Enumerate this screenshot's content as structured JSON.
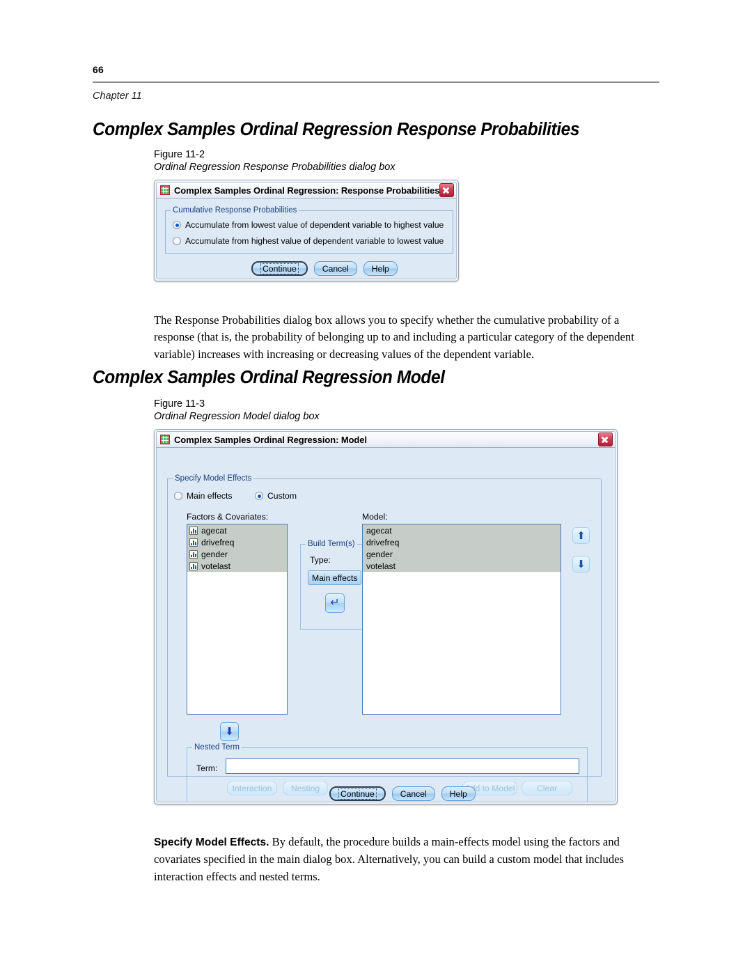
{
  "page": {
    "number": "66",
    "chapter": "Chapter 11"
  },
  "sections": [
    {
      "title": "Complex Samples Ordinal Regression Response Probabilities",
      "figure_number": "Figure 11-2",
      "figure_desc": "Ordinal Regression Response Probabilities dialog box"
    },
    {
      "title": "Complex Samples Ordinal Regression Model",
      "figure_number": "Figure 11-3",
      "figure_desc": "Ordinal Regression Model dialog box"
    }
  ],
  "paragraphs": {
    "response_probabilities": "The Response Probabilities dialog box allows you to specify whether the cumulative probability of a response (that is, the probability of belonging up to and including a particular category of the dependent variable) increases with increasing or decreasing values of the dependent variable.",
    "model_effects_lead": "Specify Model Effects.",
    "model_effects_rest": " By default, the procedure builds a main-effects model using the factors and covariates specified in the main dialog box. Alternatively, you can build a custom model that includes interaction effects and nested terms."
  },
  "dialog_response_probabilities": {
    "title": "Complex Samples Ordinal Regression: Response Probabilities",
    "close_icon": "close-icon",
    "app_icon": "spss-app-icon",
    "group_title": "Cumulative Response Probabilities",
    "radios": [
      {
        "label": "Accumulate from lowest value of dependent variable to highest value",
        "checked": true
      },
      {
        "label": "Accumulate from highest value of dependent variable to lowest value",
        "checked": false
      }
    ],
    "buttons": [
      {
        "label": "Continue",
        "default": true
      },
      {
        "label": "Cancel",
        "default": false
      },
      {
        "label": "Help",
        "default": false
      }
    ]
  },
  "dialog_model": {
    "title": "Complex Samples Ordinal Regression: Model",
    "close_icon": "close-icon",
    "app_icon": "spss-app-icon",
    "group_title": "Specify Model Effects",
    "effect_radios": [
      {
        "label": "Main effects",
        "checked": false
      },
      {
        "label": "Custom",
        "checked": true
      }
    ],
    "factors_label": "Factors & Covariates:",
    "factors_items": [
      "agecat",
      "drivefreq",
      "gender",
      "votelast"
    ],
    "model_label": "Model:",
    "model_items": [
      "agecat",
      "drivefreq",
      "gender",
      "votelast"
    ],
    "build_terms": {
      "group_title": "Build Term(s)",
      "type_label": "Type:",
      "type_value": "Main effects",
      "type_caret": "▼",
      "add_arrow": "↵"
    },
    "move_up_arrow": "⬆",
    "move_down_arrow": "⬇",
    "send_down_arrow": "⬇",
    "nested_term": {
      "group_title": "Nested Term",
      "term_label": "Term:",
      "term_value": "",
      "buttons": [
        {
          "label": "Interaction",
          "disabled": true
        },
        {
          "label": "Nesting",
          "disabled": true
        },
        {
          "label": "Add to Model",
          "disabled": true
        },
        {
          "label": "Clear",
          "disabled": true
        }
      ]
    },
    "buttons": [
      {
        "label": "Continue",
        "default": true
      },
      {
        "label": "Cancel",
        "default": false
      },
      {
        "label": "Help",
        "default": false
      }
    ]
  }
}
